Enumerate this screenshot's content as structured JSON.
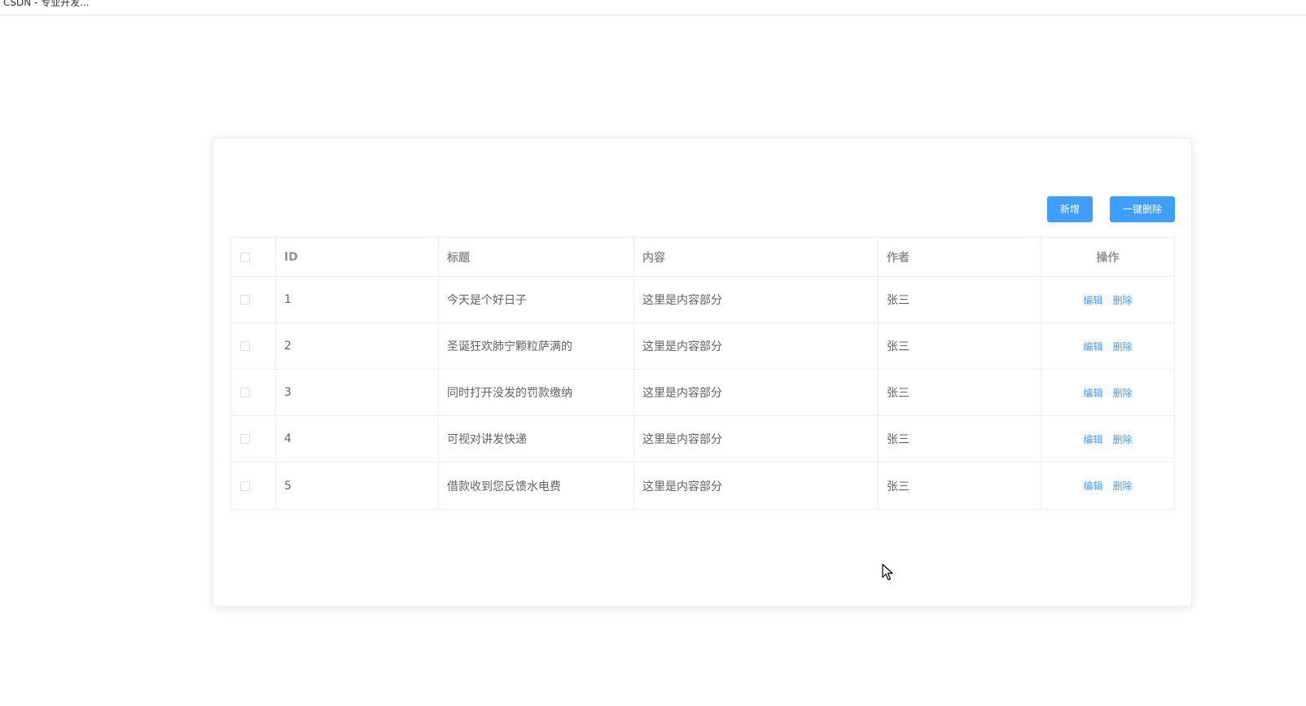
{
  "window": {
    "tab_title": "CSDN - 专业开发..."
  },
  "toolbar": {
    "add_label": "新增",
    "batch_delete_label": "一键删除"
  },
  "table": {
    "columns": [
      "ID",
      "标题",
      "内容",
      "作者",
      "操作"
    ],
    "rows": [
      {
        "id": "1",
        "title": "今天是个好日子",
        "content": "这里是内容部分",
        "author": "张三"
      },
      {
        "id": "2",
        "title": "圣诞狂欢肺宁颗粒萨满的",
        "content": "这里是内容部分",
        "author": "张三"
      },
      {
        "id": "3",
        "title": "同时打开没发的罚款缴纳",
        "content": "这里是内容部分",
        "author": "张三"
      },
      {
        "id": "4",
        "title": "可视对讲发快递",
        "content": "这里是内容部分",
        "author": "张三"
      },
      {
        "id": "5",
        "title": "借款收到您反馈水电费",
        "content": "这里是内容部分",
        "author": "张三"
      }
    ],
    "edit_label": "编辑",
    "delete_label": "删除"
  },
  "colors": {
    "primary": "#409eff",
    "border": "#ebeef5",
    "text": "#606266",
    "header_text": "#909399"
  },
  "icons": {
    "cursor": "mouse-pointer-icon"
  }
}
